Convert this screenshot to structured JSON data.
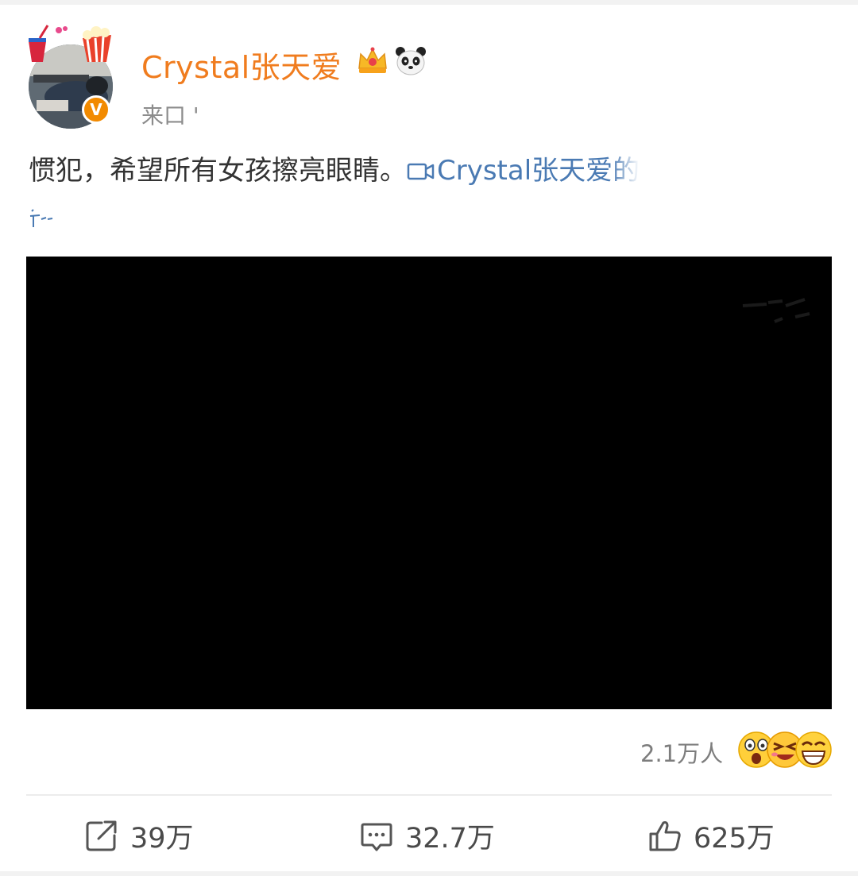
{
  "post": {
    "username": "Crystal张天爱",
    "source": "来口 '",
    "text": "惯犯，希望所有女孩擦亮眼睛。",
    "video_link": "Crystal张天爱的",
    "viewers": "2.1万人",
    "repost_count": "39万",
    "comment_count": "32.7万",
    "like_count": "625万",
    "verified_mark": "V"
  },
  "icons": {
    "user_badges": [
      "crown-icon",
      "panda-icon"
    ],
    "reactions": [
      "shocked-face-icon",
      "grin-face-icon",
      "laughing-face-icon"
    ],
    "actions": [
      "repost-icon",
      "comment-icon",
      "like-icon"
    ]
  },
  "colors": {
    "username": "#f07c1e",
    "link": "#4a7ab3",
    "verified": "#f28a00",
    "video_bg": "#000000"
  }
}
